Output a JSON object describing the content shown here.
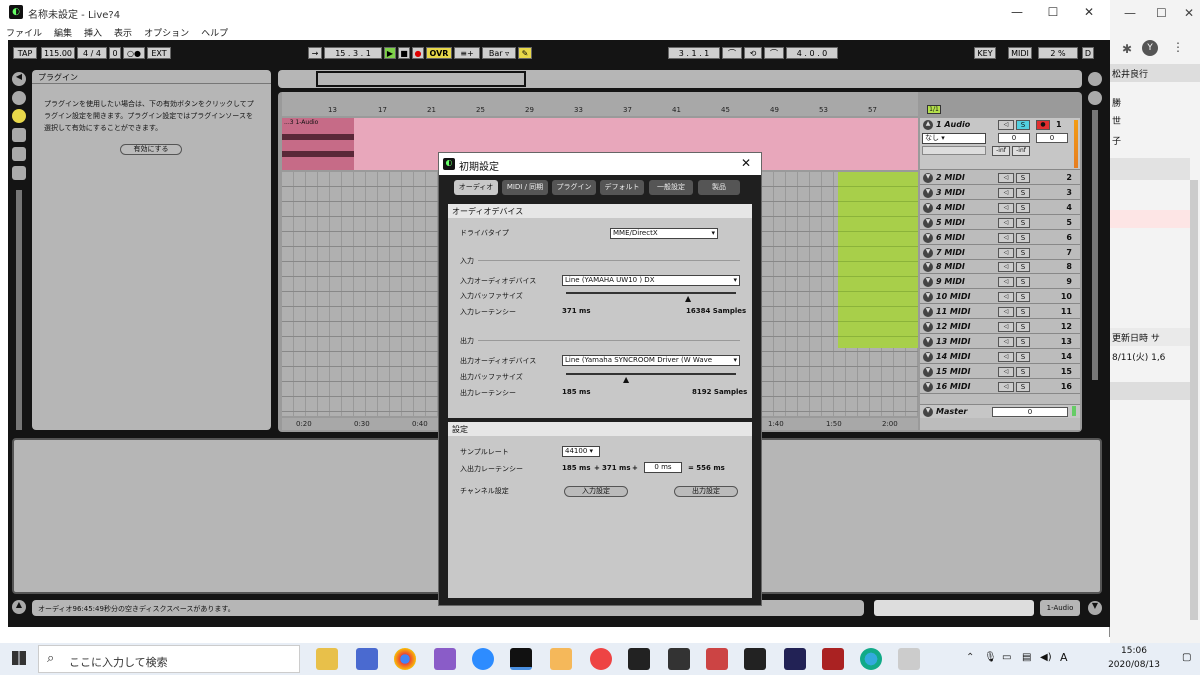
{
  "window": {
    "title": "名称未設定 - Live?4",
    "min": "—",
    "max": "☐",
    "close": "✕"
  },
  "menu": [
    "ファイル",
    "編集",
    "挿入",
    "表示",
    "オプション",
    "ヘルプ"
  ],
  "transport": {
    "tap": "TAP",
    "bpm": "115.00",
    "sig": "4 / 4",
    "zero": "0",
    "dots": "○●",
    "ext": "EXT",
    "pos": "15 . 3 . 1",
    "ovr": "OVR",
    "bar": "Bar",
    "loop_start": "3 . 1 . 1",
    "loop_len": "4 . 0 . 0",
    "key": "KEY",
    "midi": "MIDI",
    "cpu": "2 %",
    "d": "D"
  },
  "browser": {
    "title": "プラグイン",
    "text": "プラグインを使用したい場合は、下の有効ボタンをクリックしてプラグイン設定を開きます。プラグイン設定ではプラグインソースを選択して有効にすることができます。",
    "enable": "有効にする"
  },
  "arrangement": {
    "bars": [
      "13",
      "17",
      "21",
      "25",
      "29",
      "33",
      "37",
      "41",
      "45",
      "49",
      "53",
      "57"
    ],
    "clip": "...3 1-Audio",
    "marker": "1/1",
    "times": [
      "0:20",
      "0:30",
      "0:40",
      "1:40",
      "1:50",
      "2:00"
    ]
  },
  "tracks": [
    {
      "name": "1 Audio",
      "num": "1"
    },
    {
      "name": "2 MIDI",
      "num": "2"
    },
    {
      "name": "3 MIDI",
      "num": "3"
    },
    {
      "name": "4 MIDI",
      "num": "4"
    },
    {
      "name": "5 MIDI",
      "num": "5"
    },
    {
      "name": "6 MIDI",
      "num": "6"
    },
    {
      "name": "7 MIDI",
      "num": "7"
    },
    {
      "name": "8 MIDI",
      "num": "8"
    },
    {
      "name": "9 MIDI",
      "num": "9"
    },
    {
      "name": "10 MIDI",
      "num": "10"
    },
    {
      "name": "11 MIDI",
      "num": "11"
    },
    {
      "name": "12 MIDI",
      "num": "12"
    },
    {
      "name": "13 MIDI",
      "num": "13"
    },
    {
      "name": "14 MIDI",
      "num": "14"
    },
    {
      "name": "15 MIDI",
      "num": "15"
    },
    {
      "name": "16 MIDI",
      "num": "16"
    }
  ],
  "audio_track": {
    "input": "なし",
    "vol": "0",
    "pan": "0",
    "inf1": "-inf",
    "inf2": "-inf",
    "s": "S"
  },
  "master": {
    "name": "Master",
    "vol": "0"
  },
  "status": {
    "text": "オーディオ96:45:49秒分の空きディスクスペースがあります。",
    "track": "1-Audio"
  },
  "dialog": {
    "title": "初期設定",
    "close": "✕",
    "tabs": [
      "オーディオ",
      "MIDI / 同期",
      "プラグイン",
      "デフォルト",
      "一般設定",
      "製品"
    ],
    "section1": "オーディオデバイス",
    "driver_label": "ドライバタイプ",
    "driver": "MME/DirectX",
    "in_header": "入力",
    "in_dev_label": "入力オーディオデバイス",
    "in_dev": "Line (YAMAHA UW10 ) DX",
    "in_buf_label": "入力バッファサイズ",
    "in_lat_label": "入力レーテンシー",
    "in_lat": "371 ms",
    "in_samples": "16384 Samples",
    "out_header": "出力",
    "out_dev_label": "出力オーディオデバイス",
    "out_dev": "Line (Yamaha SYNCROOM Driver (W Wave",
    "out_buf_label": "出力バッファサイズ",
    "out_lat_label": "出力レーテンシー",
    "out_lat": "185 ms",
    "out_samples": "8192 Samples",
    "section2": "設定",
    "rate_label": "サンプルレート",
    "rate": "44100",
    "lat_label": "入出力レーテンシー",
    "lat_a": "185 ms",
    "plus1": "+",
    "lat_b": "371 ms",
    "plus2": "+",
    "lat_c": "0 ms",
    "eq": "= 556 ms",
    "ch_label": "チャンネル設定",
    "in_btn": "入力設定",
    "out_btn": "出力設定"
  },
  "side": {
    "name": "松井良行",
    "t1": "勝",
    "t2": "世",
    "t3": "子",
    "update": "更新日時",
    "date": "8/11(火) 1,6",
    "sa": "サ"
  },
  "taskbar": {
    "search": "ここに入力して検索",
    "time": "15:06",
    "date": "2020/08/13",
    "a": "A"
  }
}
